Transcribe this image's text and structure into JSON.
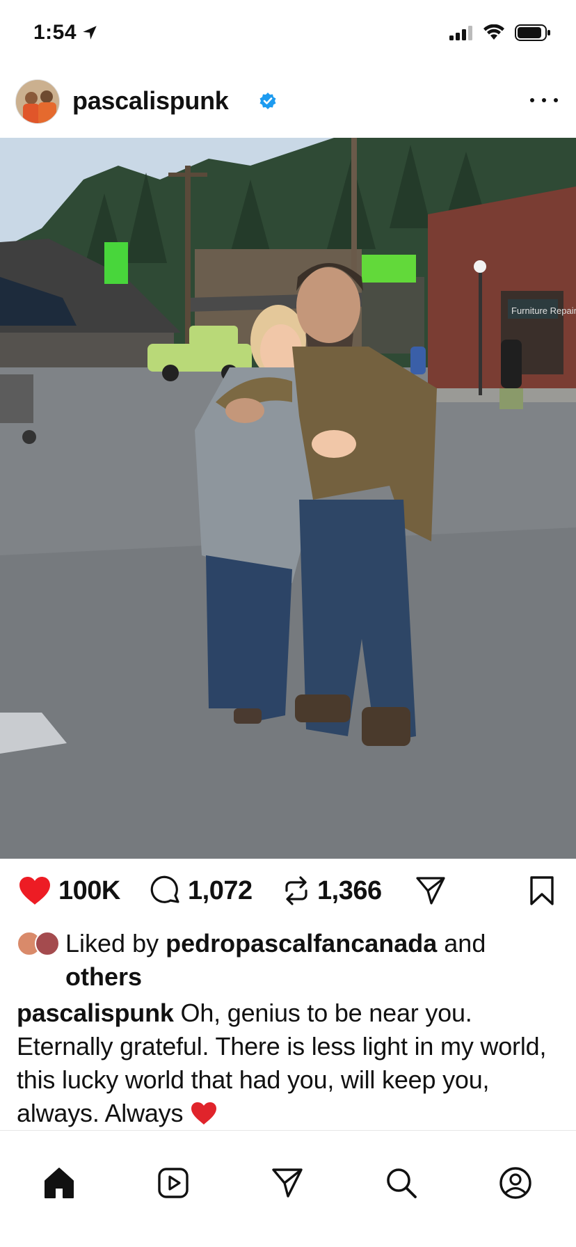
{
  "status_bar": {
    "time": "1:54",
    "icons": [
      "location-arrow-icon",
      "signal-icon",
      "wifi-icon",
      "battery-icon"
    ]
  },
  "post": {
    "username": "pascalispunk",
    "verified": true,
    "more_icon": "more-horizontal-icon",
    "photo_sign_text": "Furniture Repair",
    "likes_count": "100K",
    "comments_count": "1,072",
    "reposts_count": "1,366",
    "liked_by_prefix": "Liked by",
    "liked_by_user": "pedropascalfancanada",
    "liked_by_suffix": "and",
    "liked_by_others": "others",
    "caption_user": "pascalispunk",
    "caption_text": "Oh, genius to be near you. Eternally grateful.  There is less light in my world, this lucky world that had you, will keep you, always.  Always"
  },
  "colors": {
    "like_red": "#ed1c24",
    "verified_blue": "#1d9bf0",
    "text": "#111111"
  },
  "bottom_nav": {
    "items": [
      "home-icon",
      "reels-icon",
      "share-icon",
      "search-icon",
      "profile-icon"
    ]
  }
}
